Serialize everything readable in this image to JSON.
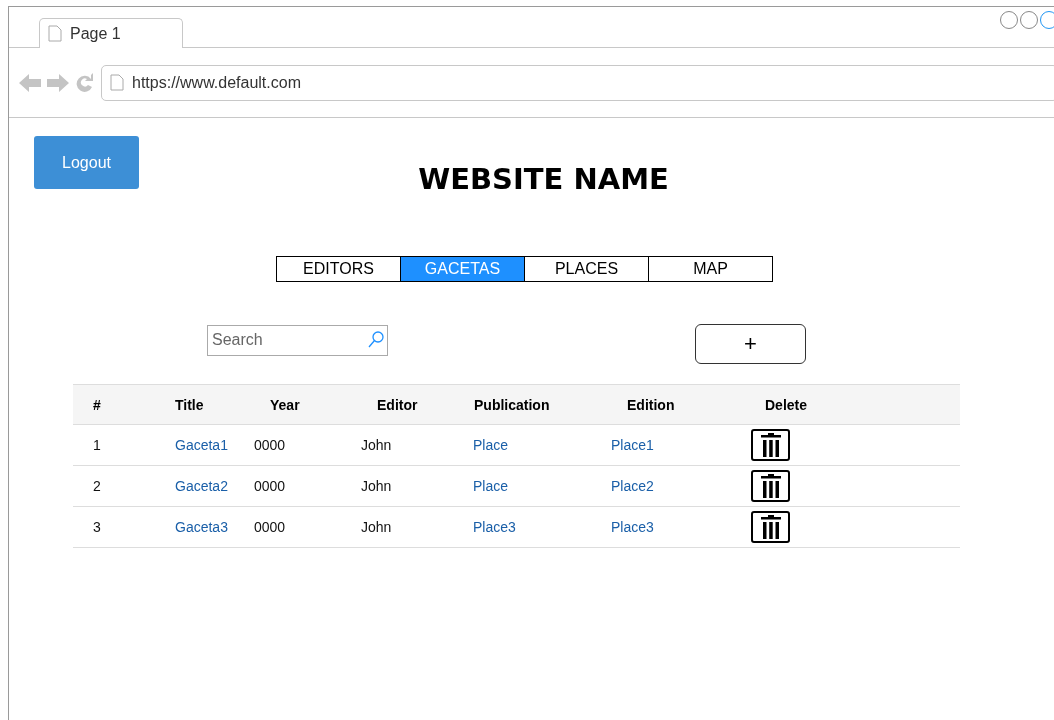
{
  "browser": {
    "tab_title": "Page 1",
    "url": "https://www.default.com"
  },
  "header": {
    "logout": "Logout",
    "site_name": "WEBSITE NAME"
  },
  "tabs": [
    {
      "label": "EDITORS",
      "selected": false
    },
    {
      "label": "GACETAS",
      "selected": true
    },
    {
      "label": "PLACES",
      "selected": false
    },
    {
      "label": "MAP",
      "selected": false
    }
  ],
  "search": {
    "placeholder": "Search"
  },
  "add_button": "+",
  "table": {
    "columns": [
      "#",
      "Title",
      "Year",
      "Editor",
      "Publication",
      "Edition",
      "Delete"
    ],
    "rows": [
      {
        "number": "1",
        "title": "Gaceta1",
        "year": "0000",
        "editor": "John",
        "publication": "Place",
        "edition": "Place1"
      },
      {
        "number": "2",
        "title": "Gaceta2",
        "year": "0000",
        "editor": "John",
        "publication": "Place",
        "edition": "Place2"
      },
      {
        "number": "3",
        "title": "Gaceta3",
        "year": "0000",
        "editor": "John",
        "publication": "Place3",
        "edition": "Place3"
      }
    ]
  }
}
